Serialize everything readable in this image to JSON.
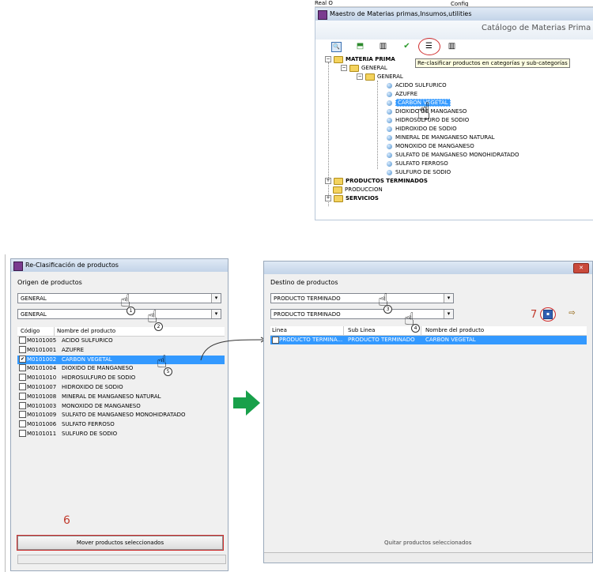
{
  "top_window": {
    "corner_text": "Real O",
    "config_text": "Config",
    "title": "Maestro de Materias primas,Insumos,utilities",
    "catalog_title": "Catálogo de Materias Prima",
    "tooltip": "Re-clasificar productos en categorías y sub-categorías",
    "tree": {
      "root": "MATERIA PRIMA",
      "level1": "GENERAL",
      "level2": "GENERAL",
      "items": [
        "ACIDO SULFURICO",
        "AZUFRE",
        "CARBON VEGETAL",
        "DIOXIDO DE MANGANESO",
        "HIDROSULFURO DE SODIO",
        "HIDROXIDO DE SODIO",
        "MINERAL DE MANGANESO NATURAL",
        "MONOXIDO DE MANGANESO",
        "SULFATO DE MANGANESO MONOHIDRATADO",
        "SULFATO FERROSO",
        "SULFURO DE SODIO"
      ],
      "others": [
        "PRODUCTOS TERMINADOS",
        "PRODUCCION",
        "SERVICIOS"
      ]
    }
  },
  "left_window": {
    "title": "Re-Clasificación de productos",
    "origin_label": "Origen de productos",
    "select1": "GENERAL",
    "select2": "GENERAL",
    "col_code": "Código",
    "col_name": "Nombre del producto",
    "rows": [
      {
        "code": "M0101005",
        "name": "ACIDO SULFURICO",
        "checked": ""
      },
      {
        "code": "M0101001",
        "name": "AZUFRE",
        "checked": ""
      },
      {
        "code": "M0101002",
        "name": "CARBON VEGETAL",
        "checked": "✔"
      },
      {
        "code": "M0101004",
        "name": "DIOXIDO DE MANGANESO",
        "checked": ""
      },
      {
        "code": "M0101010",
        "name": "HIDROSULFURO DE SODIO",
        "checked": ""
      },
      {
        "code": "M0101007",
        "name": "HIDROXIDO DE SODIO",
        "checked": ""
      },
      {
        "code": "M0101008",
        "name": "MINERAL DE MANGANESO NATURAL",
        "checked": ""
      },
      {
        "code": "M0101003",
        "name": "MONOXIDO DE MANGANESO",
        "checked": ""
      },
      {
        "code": "M0101009",
        "name": "SULFATO DE MANGANESO MONOHIDRATADO",
        "checked": ""
      },
      {
        "code": "M0101006",
        "name": "SULFATO FERROSO",
        "checked": ""
      },
      {
        "code": "M0101011",
        "name": "SULFURO DE SODIO",
        "checked": ""
      }
    ],
    "move_button": "Mover productos seleccionados"
  },
  "right_window": {
    "dest_label": "Destino de productos",
    "select1": "PRODUCTO TERMINADO",
    "select2": "PRODUCTO TERMINADO",
    "col_line": "Linea",
    "col_subline": "Sub Linea",
    "col_name": "Nombre del producto",
    "row": {
      "line": "PRODUCTO TERMINA...",
      "subline": "PRODUCTO TERMINADO",
      "name": "CARBON VEGETAL"
    },
    "remove_button": "Quitar productos seleccionados",
    "close": "✕"
  },
  "annotations": {
    "step1": "1",
    "step2": "2",
    "step3": "3",
    "step4": "4",
    "step5": "5",
    "step6": "6",
    "step7": "7"
  },
  "icons": [
    "search-icon",
    "export-icon",
    "grid-icon",
    "check-icon",
    "list-icon",
    "columns-icon",
    "save-icon",
    "exit-icon",
    "hand-pointer-icon",
    "arrow-right-icon"
  ]
}
